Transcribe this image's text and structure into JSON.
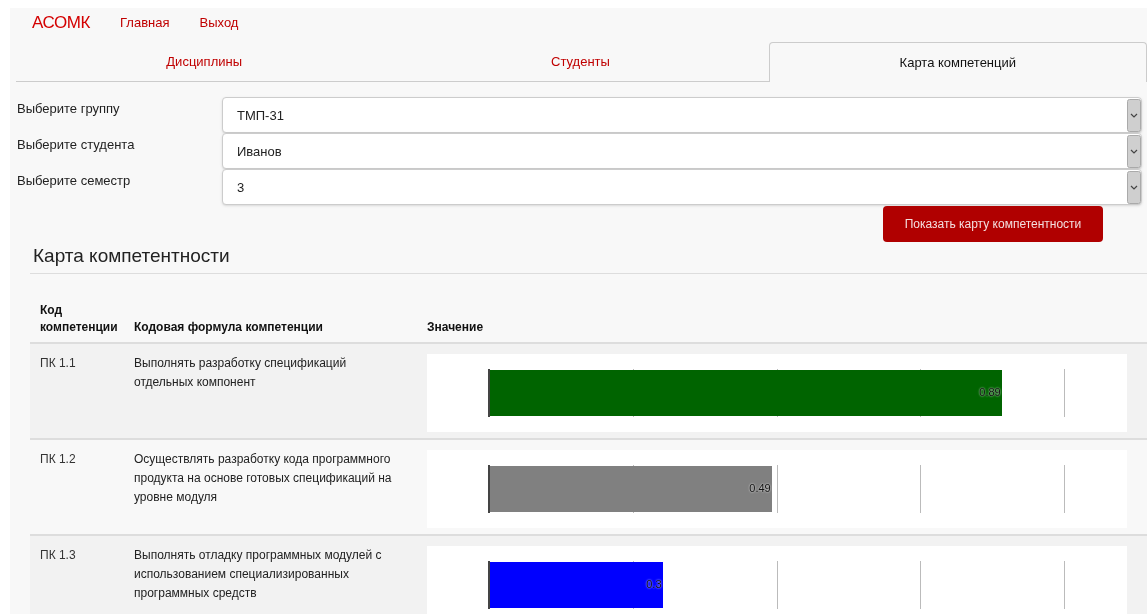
{
  "nav": {
    "brand": "АСОМК",
    "links": [
      "Главная",
      "Выход"
    ]
  },
  "tabs": [
    {
      "label": "Дисциплины",
      "selected": false
    },
    {
      "label": "Студенты",
      "selected": false
    },
    {
      "label": "Карта компетенций",
      "selected": true
    }
  ],
  "filters": [
    {
      "label": "Выберите группу",
      "value": "ТМП-31"
    },
    {
      "label": "Выберите студента",
      "value": "Иванов"
    },
    {
      "label": "Выберите семестр",
      "value": "3"
    }
  ],
  "show_button": "Показать карту компетентности",
  "section_title": "Карта компетентности",
  "table": {
    "columns": [
      "Код компетенции",
      "Кодовая формула компетенции",
      "Значение"
    ],
    "rows": [
      {
        "code": "ПК 1.1",
        "formula": "Выполнять разработку спецификаций отдельных компонент",
        "level": 0.89,
        "reading": "0.89",
        "color": "#006400"
      },
      {
        "code": "ПК 1.2",
        "formula": "Осуществлять разработку кода программного продукта на основе готовых спецификаций на уровне модуля",
        "level": 0.49,
        "reading": "0.49",
        "color": "#808080"
      },
      {
        "code": "ПК 1.3",
        "formula": "Выполнять отладку программных модулей с использованием специализированных программных средств",
        "level": 0.3,
        "reading": "0.3",
        "color": "#0000ff"
      }
    ]
  }
}
